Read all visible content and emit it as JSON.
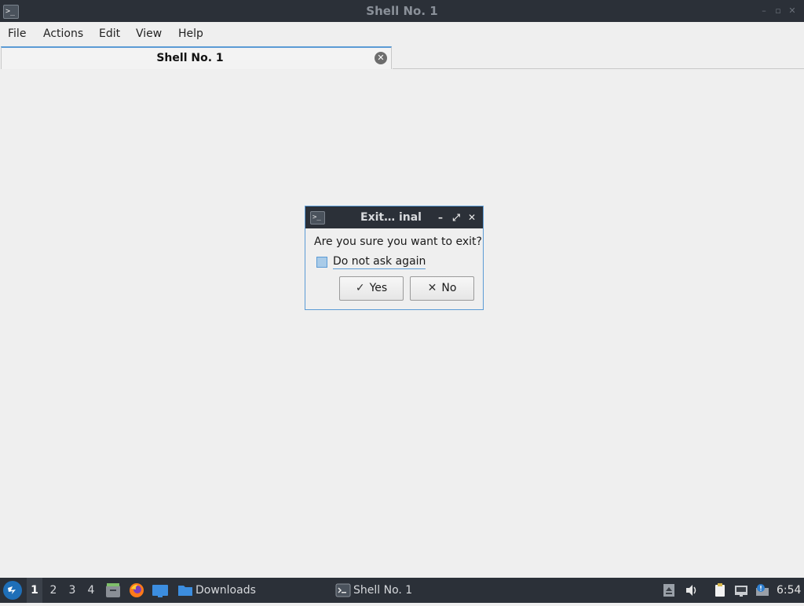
{
  "window": {
    "title": "Shell No. 1",
    "app_icon_glyph": ">_",
    "controls": {
      "minimize": "–",
      "maximize": "▫",
      "close": "✕"
    }
  },
  "menubar": {
    "items": [
      "File",
      "Actions",
      "Edit",
      "View",
      "Help"
    ]
  },
  "tabs": [
    {
      "label": "Shell No. 1",
      "active": true,
      "close_glyph": "✕"
    }
  ],
  "dialog": {
    "title": "Exit…  inal",
    "icon_glyph": ">_",
    "controls": {
      "minimize": "–",
      "maximize": "⤢",
      "close": "✕"
    },
    "question": "Are you sure you want to exit?",
    "checkbox_label": "Do not ask again",
    "checkbox_checked": false,
    "yes_label": "Yes",
    "yes_icon": "✓",
    "no_label": "No",
    "no_icon": "✕"
  },
  "taskbar": {
    "start_icon": "start-menu-icon",
    "workspaces": [
      "1",
      "2",
      "3",
      "4"
    ],
    "active_workspace": "1",
    "launchers": [
      "file-manager-icon",
      "firefox-icon",
      "desktop-icon"
    ],
    "tasks": [
      {
        "label": "Downloads",
        "icon": "folder-icon"
      },
      {
        "label": "Shell No. 1",
        "icon": "terminal-icon"
      }
    ],
    "tray": [
      "removable-drive-icon",
      "volume-icon",
      "clipboard-icon",
      "network-icon",
      "notification-icon"
    ],
    "clock": "6:54"
  },
  "colors": {
    "accent": "#5b9bd5",
    "titlebar": "#2b3038",
    "background": "#efefef"
  }
}
